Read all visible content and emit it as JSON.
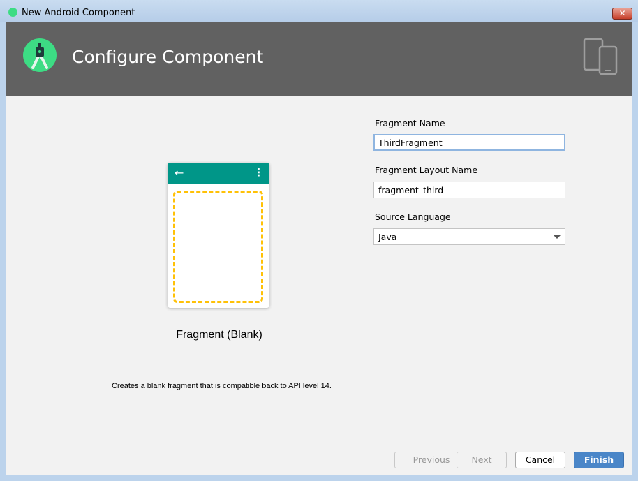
{
  "window": {
    "title": "New Android Component",
    "close_label": "✕"
  },
  "header": {
    "title": "Configure Component"
  },
  "preview": {
    "template_name": "Fragment (Blank)",
    "description": "Creates a blank fragment that is compatible back to API level 14.",
    "toolbar_color": "#009688",
    "placeholder_color": "#ffc107"
  },
  "form": {
    "fragment_name": {
      "label": "Fragment Name",
      "value": "ThirdFragment"
    },
    "layout_name": {
      "label": "Fragment Layout Name",
      "value": "fragment_third"
    },
    "source_language": {
      "label": "Source Language",
      "value": "Java"
    }
  },
  "buttons": {
    "previous": "Previous",
    "next": "Next",
    "cancel": "Cancel",
    "finish": "Finish"
  }
}
